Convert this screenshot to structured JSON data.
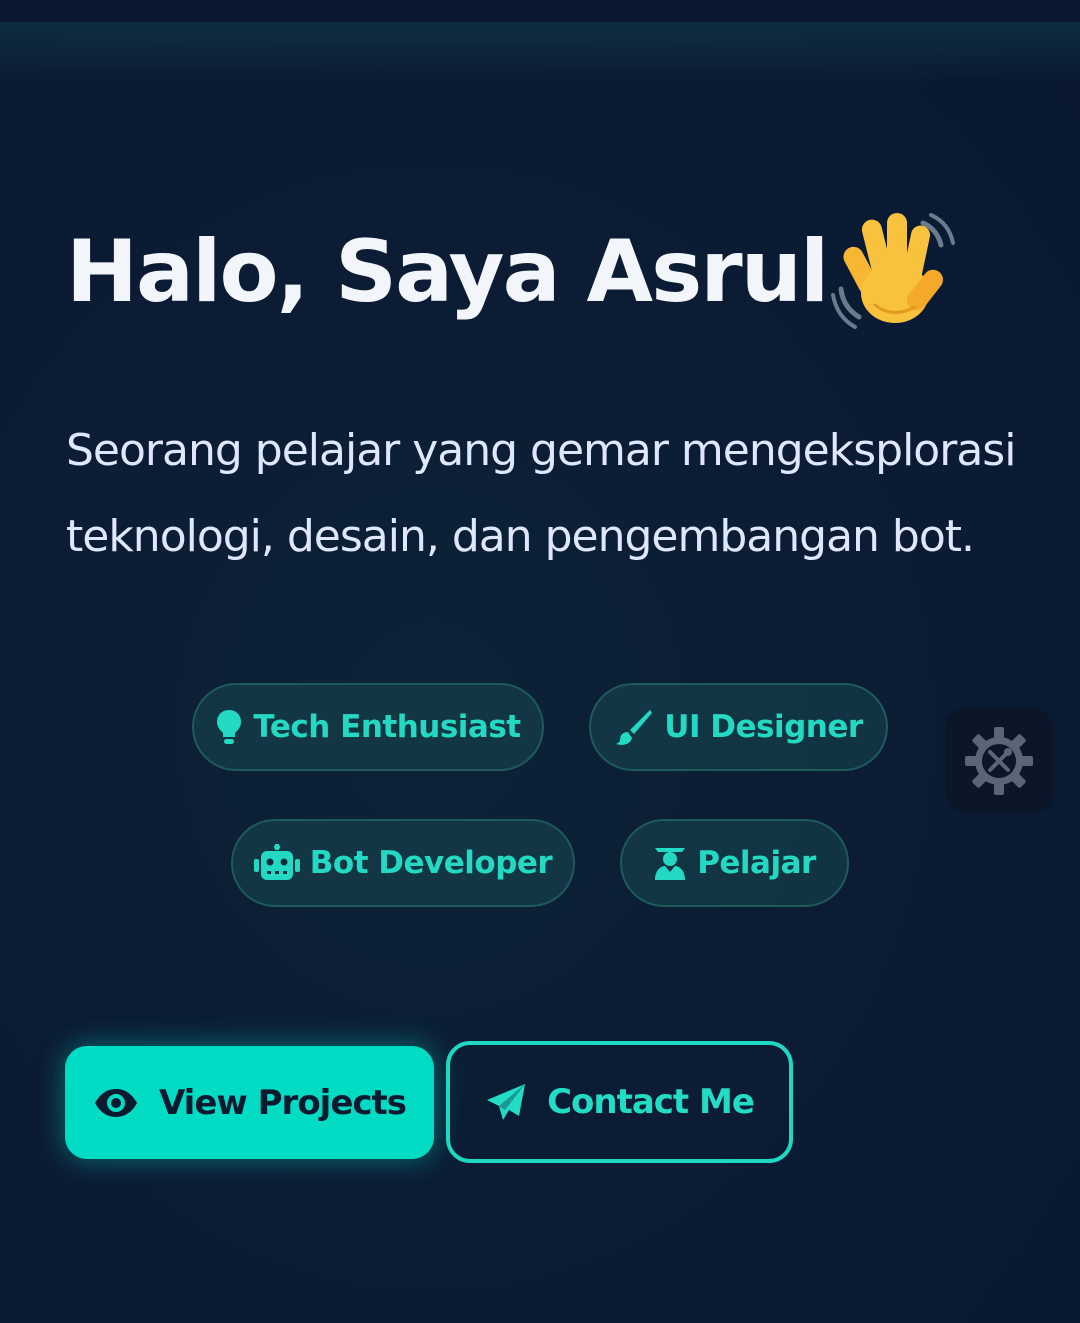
{
  "hero": {
    "title": "Halo, Saya Asrul",
    "title_emoji_icon": "waving-hand-icon",
    "subtitle_line1": "Seorang pelajar yang gemar mengeksplorasi",
    "subtitle_line2": "teknologi, desain, dan pengembangan bot."
  },
  "roles": [
    {
      "label": "Tech Enthusiast",
      "icon": "lightbulb-icon"
    },
    {
      "label": "UI Designer",
      "icon": "paintbrush-icon"
    },
    {
      "label": "Bot Developer",
      "icon": "robot-icon"
    },
    {
      "label": "Pelajar",
      "icon": "graduate-icon"
    }
  ],
  "actions": {
    "primary_label": "View Projects",
    "primary_icon": "eye-icon",
    "secondary_label": "Contact Me",
    "secondary_icon": "paper-plane-icon"
  },
  "settings": {
    "icon": "gear-tools-icon"
  },
  "colors": {
    "background": "#0b1a33",
    "accent": "#00dcc4",
    "title": "#f2f6fb",
    "subtitle": "#dfe6ff",
    "pill_border": "#1d5a5c",
    "pill_text": "#23d9c3"
  }
}
